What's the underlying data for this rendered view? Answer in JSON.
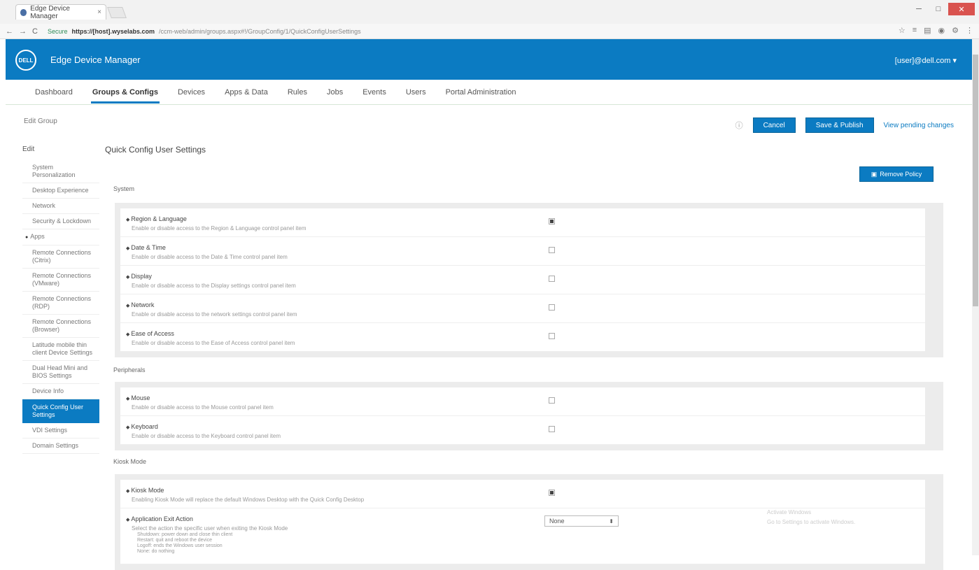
{
  "browser": {
    "tab_title": "Edge Device Manager",
    "tab_close": "×",
    "url_secure": "Secure",
    "url_host": "https://[host].wyselabs.com",
    "url_path": "/ccm-web/admin/groups.aspx#!/GroupConfig/1/QuickConfigUserSettings",
    "nav_back": "←",
    "nav_forward": "→",
    "nav_reload": "C",
    "window_min": "─",
    "window_max": "□",
    "window_close": "✕",
    "ext_icons": [
      "☆",
      "≡",
      "▤",
      "◉",
      "⚙",
      "⋮"
    ]
  },
  "app": {
    "logo_text": "DELL",
    "title": "Edge Device Manager",
    "user": "[user]@dell.com ▾"
  },
  "topnav": {
    "items": [
      "Dashboard",
      "Groups & Configs",
      "Devices",
      "Apps & Data",
      "Rules",
      "Jobs",
      "Events",
      "Users",
      "Portal Administration"
    ],
    "active_index": 1
  },
  "breadcrumb": "Edit Group",
  "actions": {
    "info": "ⓘ",
    "cancel": "Cancel",
    "save": "Save & Publish",
    "view_pending": "View pending changes"
  },
  "sidebar": {
    "heading": "Edit",
    "items": [
      {
        "label": "System Personalization",
        "dot": false,
        "active": false
      },
      {
        "label": "Desktop Experience",
        "dot": false,
        "active": false
      },
      {
        "label": "Network",
        "dot": false,
        "active": false
      },
      {
        "label": "Security & Lockdown",
        "dot": false,
        "active": false
      },
      {
        "label": "Apps",
        "dot": true,
        "active": false
      },
      {
        "label": "Remote Connections (Citrix)",
        "dot": false,
        "active": false
      },
      {
        "label": "Remote Connections (VMware)",
        "dot": false,
        "active": false
      },
      {
        "label": "Remote Connections (RDP)",
        "dot": false,
        "active": false
      },
      {
        "label": "Remote Connections (Browser)",
        "dot": false,
        "active": false
      },
      {
        "label": "Latitude mobile thin client Device Settings",
        "dot": false,
        "active": false
      },
      {
        "label": "Dual Head Mini and BIOS Settings",
        "dot": false,
        "active": false
      },
      {
        "label": "Device Info",
        "dot": false,
        "active": false
      },
      {
        "label": "Quick Config User Settings",
        "dot": false,
        "active": true
      },
      {
        "label": "VDI Settings",
        "dot": false,
        "active": false
      },
      {
        "label": "Domain Settings",
        "dot": false,
        "active": false
      }
    ]
  },
  "main": {
    "title": "Quick Config User Settings",
    "remove_policy": "Remove Policy",
    "sections": [
      {
        "label": "System",
        "settings": [
          {
            "name": "Region & Language",
            "desc": "Enable or disable access to the Region & Language control panel item",
            "checked": true
          },
          {
            "name": "Date & Time",
            "desc": "Enable or disable access to the Date & Time control panel item",
            "checked": false
          },
          {
            "name": "Display",
            "desc": "Enable or disable access to the Display settings control panel item",
            "checked": false
          },
          {
            "name": "Network",
            "desc": "Enable or disable access to the network settings control panel item",
            "checked": false
          },
          {
            "name": "Ease of Access",
            "desc": "Enable or disable access to the Ease of Access control panel item",
            "checked": false
          }
        ]
      },
      {
        "label": "Peripherals",
        "settings": [
          {
            "name": "Mouse",
            "desc": "Enable or disable access to the Mouse control panel item",
            "checked": false
          },
          {
            "name": "Keyboard",
            "desc": "Enable or disable access to the Keyboard control panel item",
            "checked": false
          }
        ]
      },
      {
        "label": "Kiosk Mode",
        "settings": [
          {
            "name": "Kiosk Mode",
            "desc": "Enabling Kiosk Mode will replace the default Windows Desktop with the Quick Config Desktop",
            "checked": true
          },
          {
            "name": "Application Exit Action",
            "desc": "Select the action the specific user when exiting the Kiosk Mode",
            "select": "None",
            "bullets": [
              "Shutdown: power down and close thin client",
              "Restart: quit and reboot the device",
              "Logoff: ends the Windows user session",
              "None: do nothing"
            ]
          }
        ]
      }
    ]
  },
  "watermark": [
    "Activate Windows",
    "Go to Settings to activate Windows."
  ]
}
